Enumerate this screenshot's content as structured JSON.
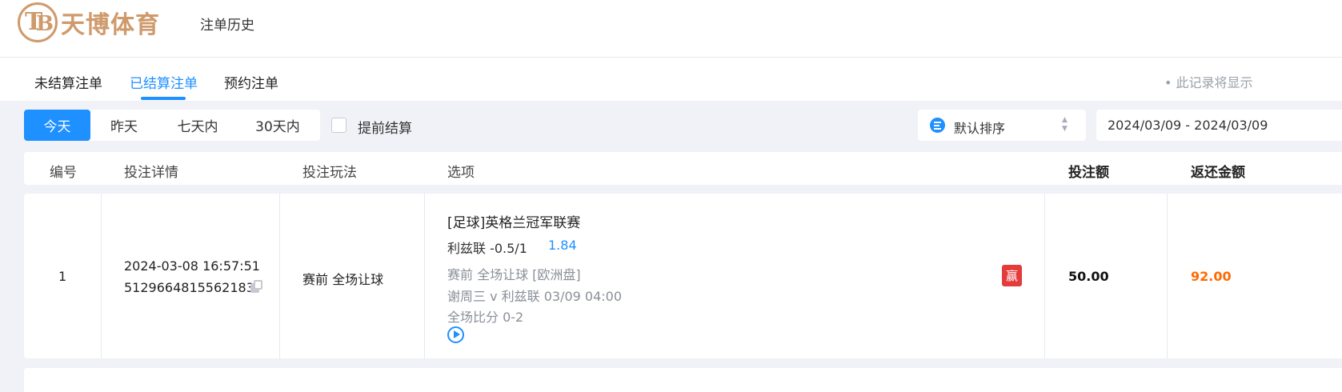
{
  "header": {
    "logo_text": "天博体育",
    "logo_glyph_t": "T",
    "logo_glyph_b": "B",
    "title": "注单历史"
  },
  "tabs": [
    {
      "label": "未结算注单",
      "active": false
    },
    {
      "label": "已结算注单",
      "active": true
    },
    {
      "label": "预约注单",
      "active": false
    }
  ],
  "record_note": "• 此记录将显示",
  "filters": {
    "ranges": [
      {
        "label": "今天",
        "active": true
      },
      {
        "label": "昨天",
        "active": false
      },
      {
        "label": "七天内",
        "active": false
      },
      {
        "label": "30天内",
        "active": false
      }
    ],
    "early_settle_label": "提前结算",
    "early_settle_checked": false,
    "sort_label": "默认排序",
    "date_range": "2024/03/09 - 2024/03/09"
  },
  "table": {
    "columns": [
      "编号",
      "投注详情",
      "投注玩法",
      "选项",
      "投注额",
      "返还金额"
    ],
    "rows": [
      {
        "id": "1",
        "datetime": "2024-03-08 16:57:51",
        "order_no": "5129664815562183",
        "bet_type": "赛前 全场让球",
        "league": "[足球]英格兰冠军联赛",
        "pick": "利兹联 -0.5/1",
        "odds": "1.84",
        "market_line": "赛前   全场让球   [欧洲盘]",
        "match": "谢周三 v 利兹联    03/09 04:00",
        "score": "全场比分 0-2",
        "result": "赢",
        "stake": "50.00",
        "payout": "92.00"
      }
    ]
  },
  "colors": {
    "accent": "#1e90ff",
    "brand": "#cf9a6b",
    "win": "#e43b3b",
    "payout": "#ff6a00",
    "background": "#f0f2f7"
  }
}
